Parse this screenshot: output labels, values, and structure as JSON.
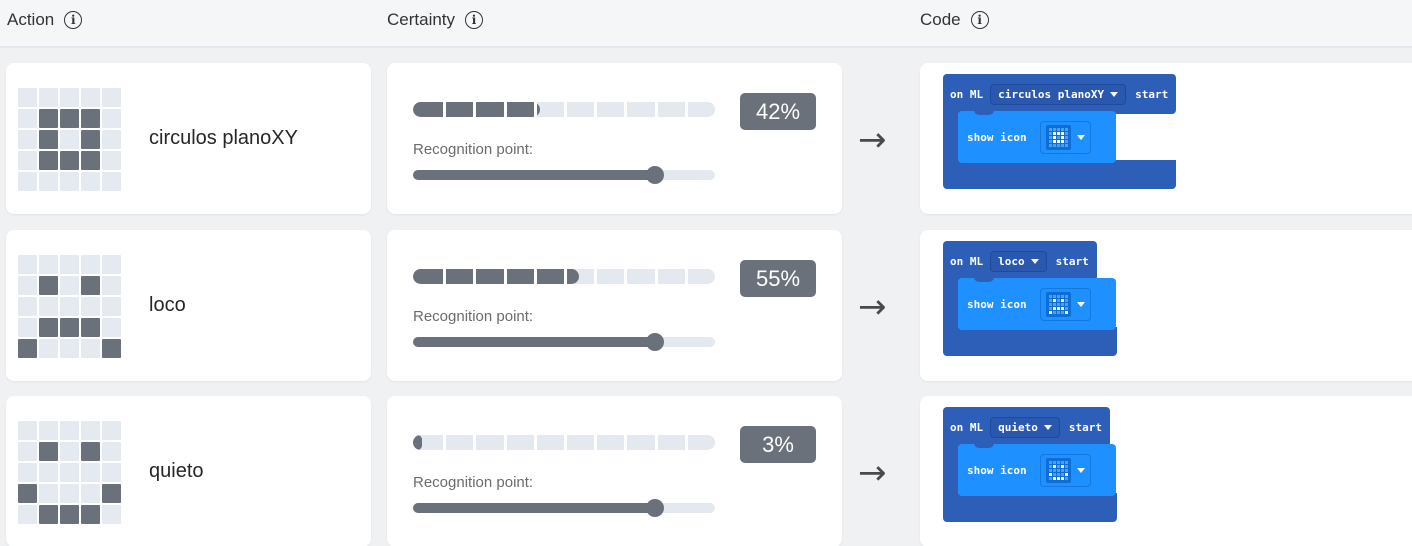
{
  "header": {
    "action_label": "Action",
    "certainty_label": "Certainty",
    "code_label": "Code",
    "info_icon": "ⓘ"
  },
  "rows": [
    {
      "name": "circulos planoXY",
      "certainty": "42%",
      "certainty_value": 0.42,
      "recognition_label": "Recognition point:",
      "recognition_point": 0.8,
      "arrow": "→",
      "pattern": [
        [
          0,
          0,
          0,
          0,
          0
        ],
        [
          0,
          1,
          1,
          1,
          0
        ],
        [
          0,
          1,
          0,
          1,
          0
        ],
        [
          0,
          1,
          1,
          1,
          0
        ],
        [
          0,
          0,
          0,
          0,
          0
        ]
      ],
      "code": {
        "on": "on ML",
        "gesture": "circulos planoXY",
        "start": "start",
        "show": "show icon"
      }
    },
    {
      "name": "loco",
      "certainty": "55%",
      "certainty_value": 0.55,
      "recognition_label": "Recognition point:",
      "recognition_point": 0.8,
      "arrow": "→",
      "pattern": [
        [
          0,
          0,
          0,
          0,
          0
        ],
        [
          0,
          1,
          0,
          1,
          0
        ],
        [
          0,
          0,
          0,
          0,
          0
        ],
        [
          0,
          1,
          1,
          1,
          0
        ],
        [
          1,
          0,
          0,
          0,
          1
        ]
      ],
      "code": {
        "on": "on ML",
        "gesture": "loco",
        "start": "start",
        "show": "show icon"
      }
    },
    {
      "name": "quieto",
      "certainty": "3%",
      "certainty_value": 0.03,
      "recognition_label": "Recognition point:",
      "recognition_point": 0.8,
      "arrow": "→",
      "pattern": [
        [
          0,
          0,
          0,
          0,
          0
        ],
        [
          0,
          1,
          0,
          1,
          0
        ],
        [
          0,
          0,
          0,
          0,
          0
        ],
        [
          1,
          0,
          0,
          0,
          1
        ],
        [
          0,
          1,
          1,
          1,
          0
        ]
      ],
      "code": {
        "on": "on ML",
        "gesture": "quieto",
        "start": "start",
        "show": "show icon"
      }
    }
  ],
  "colors": {
    "block_dark": "#2e5fb8",
    "block_light": "#1e90ff",
    "meter": "#6b717a",
    "track": "#e4e9f0"
  }
}
